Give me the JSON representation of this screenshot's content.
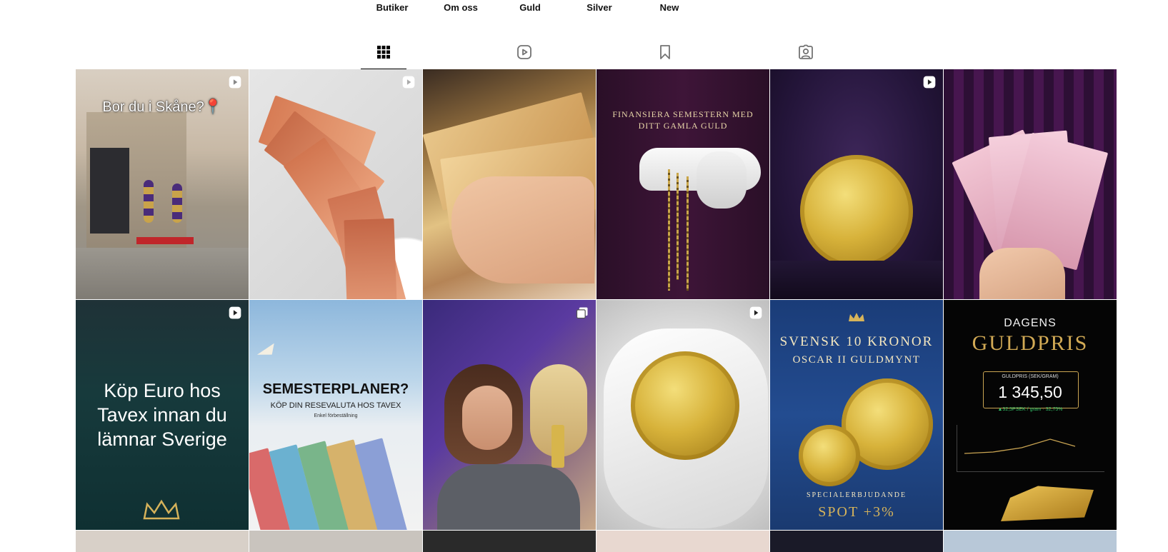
{
  "highlights": [
    {
      "label": "Butiker"
    },
    {
      "label": "Om oss"
    },
    {
      "label": "Guld"
    },
    {
      "label": "Silver"
    },
    {
      "label": "New"
    }
  ],
  "tabs": [
    {
      "name": "posts",
      "icon": "grid-icon",
      "active": true
    },
    {
      "name": "reels",
      "icon": "reels-icon",
      "active": false
    },
    {
      "name": "saved",
      "icon": "bookmark-icon",
      "active": false
    },
    {
      "name": "tagged",
      "icon": "tagged-user-icon",
      "active": false
    }
  ],
  "posts": [
    {
      "caption": "Bor du i Skåne?📍",
      "badge": "reel-icon"
    },
    {
      "caption": "",
      "badge": "reel-icon"
    },
    {
      "caption": "",
      "badge": ""
    },
    {
      "caption_line1": "FINANSIERA SEMESTERN MED",
      "caption_line2": "DITT GAMLA GULD",
      "badge": ""
    },
    {
      "caption": "",
      "badge": "reel-icon"
    },
    {
      "caption": "",
      "badge": ""
    },
    {
      "caption_line1": "Köp Euro hos",
      "caption_line2": "Tavex innan du",
      "caption_line3": "lämnar Sverige",
      "badge": "reel-icon"
    },
    {
      "headline": "SEMESTERPLANER?",
      "subline": "KÖP DIN RESEVALUTA HOS TAVEX",
      "small": "Enkel förbeställning",
      "badge": ""
    },
    {
      "caption": "",
      "badge": "carousel-icon"
    },
    {
      "caption": "",
      "badge": "reel-icon"
    },
    {
      "line1": "SVENSK 10 KRONOR",
      "line2": "OSCAR II GULDMYNT",
      "line3": "SPECIALERBJUDANDE",
      "line4": "SPOT +3%",
      "badge": ""
    },
    {
      "title_small": "DAGENS",
      "title_big": "GULDPRIS",
      "price_label": "GULDPRIS (SEK/GRAM)",
      "price": "1 345,50",
      "change": "▲32,5PSEK / gram · 32,75%",
      "badge": ""
    }
  ]
}
